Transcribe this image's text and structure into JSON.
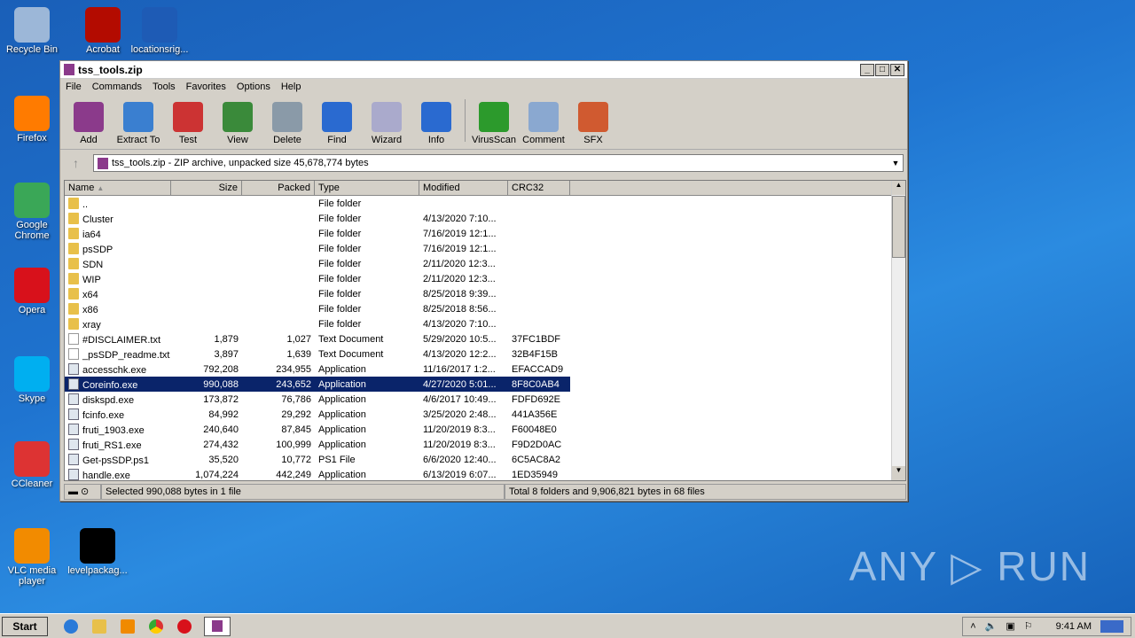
{
  "desktop": {
    "icons": [
      {
        "label": "Recycle Bin",
        "color": "#9cb7d8"
      },
      {
        "label": "Acrobat",
        "color": "#b30b00"
      },
      {
        "label": "locationsrig...",
        "color": "#1e5bb5"
      },
      {
        "label": "Firefox",
        "color": "#ff7b00"
      },
      {
        "label": "Google Chrome",
        "color": "#3aa757"
      },
      {
        "label": "Opera",
        "color": "#d8111b"
      },
      {
        "label": "Skype",
        "color": "#00aff0"
      },
      {
        "label": "CCleaner",
        "color": "#d33"
      },
      {
        "label": "VLC media player",
        "color": "#f28b00"
      },
      {
        "label": "levelpackag...",
        "color": "#000"
      }
    ]
  },
  "window": {
    "title": "tss_tools.zip",
    "menu": [
      "File",
      "Commands",
      "Tools",
      "Favorites",
      "Options",
      "Help"
    ],
    "toolbar": [
      {
        "label": "Add",
        "color": "#8b3a8b"
      },
      {
        "label": "Extract To",
        "color": "#3a7fd0"
      },
      {
        "label": "Test",
        "color": "#c33"
      },
      {
        "label": "View",
        "color": "#3a8a3a"
      },
      {
        "label": "Delete",
        "color": "#8a9aa8"
      },
      {
        "label": "Find",
        "color": "#2a6ad0"
      },
      {
        "label": "Wizard",
        "color": "#aac"
      },
      {
        "label": "Info",
        "color": "#2a6ad0"
      },
      {
        "label": "VirusScan",
        "color": "#2c9a2c"
      },
      {
        "label": "Comment",
        "color": "#8aa8d0"
      },
      {
        "label": "SFX",
        "color": "#d05a30"
      }
    ],
    "address": "tss_tools.zip - ZIP archive, unpacked size 45,678,774 bytes",
    "columns": [
      "Name",
      "Size",
      "Packed",
      "Type",
      "Modified",
      "CRC32"
    ],
    "rows": [
      {
        "name": "..",
        "size": "",
        "packed": "",
        "type": "File folder",
        "modified": "",
        "crc": "",
        "kind": "fold"
      },
      {
        "name": "Cluster",
        "size": "",
        "packed": "",
        "type": "File folder",
        "modified": "4/13/2020 7:10...",
        "crc": "",
        "kind": "fold"
      },
      {
        "name": "ia64",
        "size": "",
        "packed": "",
        "type": "File folder",
        "modified": "7/16/2019 12:1...",
        "crc": "",
        "kind": "fold"
      },
      {
        "name": "psSDP",
        "size": "",
        "packed": "",
        "type": "File folder",
        "modified": "7/16/2019 12:1...",
        "crc": "",
        "kind": "fold"
      },
      {
        "name": "SDN",
        "size": "",
        "packed": "",
        "type": "File folder",
        "modified": "2/11/2020 12:3...",
        "crc": "",
        "kind": "fold"
      },
      {
        "name": "WIP",
        "size": "",
        "packed": "",
        "type": "File folder",
        "modified": "2/11/2020 12:3...",
        "crc": "",
        "kind": "fold"
      },
      {
        "name": "x64",
        "size": "",
        "packed": "",
        "type": "File folder",
        "modified": "8/25/2018 9:39...",
        "crc": "",
        "kind": "fold"
      },
      {
        "name": "x86",
        "size": "",
        "packed": "",
        "type": "File folder",
        "modified": "8/25/2018 8:56...",
        "crc": "",
        "kind": "fold"
      },
      {
        "name": "xray",
        "size": "",
        "packed": "",
        "type": "File folder",
        "modified": "4/13/2020 7:10...",
        "crc": "",
        "kind": "fold"
      },
      {
        "name": "#DISCLAIMER.txt",
        "size": "1,879",
        "packed": "1,027",
        "type": "Text Document",
        "modified": "5/29/2020 10:5...",
        "crc": "37FC1BDF",
        "kind": "file"
      },
      {
        "name": "_psSDP_readme.txt",
        "size": "3,897",
        "packed": "1,639",
        "type": "Text Document",
        "modified": "4/13/2020 12:2...",
        "crc": "32B4F15B",
        "kind": "file"
      },
      {
        "name": "accesschk.exe",
        "size": "792,208",
        "packed": "234,955",
        "type": "Application",
        "modified": "11/16/2017 1:2...",
        "crc": "EFACCAD9",
        "kind": "app"
      },
      {
        "name": "Coreinfo.exe",
        "size": "990,088",
        "packed": "243,652",
        "type": "Application",
        "modified": "4/27/2020 5:01...",
        "crc": "8F8C0AB4",
        "kind": "app",
        "selected": true
      },
      {
        "name": "diskspd.exe",
        "size": "173,872",
        "packed": "76,786",
        "type": "Application",
        "modified": "4/6/2017 10:49...",
        "crc": "FDFD692E",
        "kind": "app"
      },
      {
        "name": "fcinfo.exe",
        "size": "84,992",
        "packed": "29,292",
        "type": "Application",
        "modified": "3/25/2020 2:48...",
        "crc": "441A356E",
        "kind": "app"
      },
      {
        "name": "fruti_1903.exe",
        "size": "240,640",
        "packed": "87,845",
        "type": "Application",
        "modified": "11/20/2019 8:3...",
        "crc": "F60048E0",
        "kind": "app"
      },
      {
        "name": "fruti_RS1.exe",
        "size": "274,432",
        "packed": "100,999",
        "type": "Application",
        "modified": "11/20/2019 8:3...",
        "crc": "F9D2D0AC",
        "kind": "app"
      },
      {
        "name": "Get-psSDP.ps1",
        "size": "35,520",
        "packed": "10,772",
        "type": "PS1 File",
        "modified": "6/6/2020 12:40...",
        "crc": "6C5AC8A2",
        "kind": "app"
      },
      {
        "name": "handle.exe",
        "size": "1,074,224",
        "packed": "442,249",
        "type": "Application",
        "modified": "6/13/2019 6:07...",
        "crc": "1ED35949",
        "kind": "app"
      }
    ],
    "status_left": "Selected 990,088 bytes in 1 file",
    "status_right": "Total 8 folders and 9,906,821 bytes in 68 files"
  },
  "taskbar": {
    "start": "Start",
    "clock": "9:41 AM"
  },
  "watermark": "ANY ▷ RUN"
}
